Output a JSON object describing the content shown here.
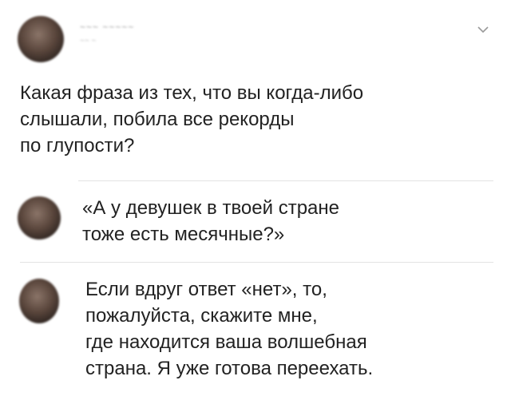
{
  "post": {
    "author_name": "~~~ ~~~~~",
    "author_handle": "~~ ~",
    "text": "Какая фраза из тех, что вы когда-либо\nслышали, побила все рекорды\nпо глупости?"
  },
  "icons": {
    "menu": "chevron-down-icon"
  },
  "replies": [
    {
      "text": "«А у девушек в твоей стране\nтоже есть месячные?»"
    },
    {
      "text": "Если вдруг ответ «нет», то,\nпожалуйста, скажите мне,\nгде находится ваша волшебная\nстрана. Я уже готова переехать."
    }
  ],
  "colors": {
    "text": "#222222",
    "muted": "#9a9a9a",
    "divider": "#e3e3e3"
  }
}
